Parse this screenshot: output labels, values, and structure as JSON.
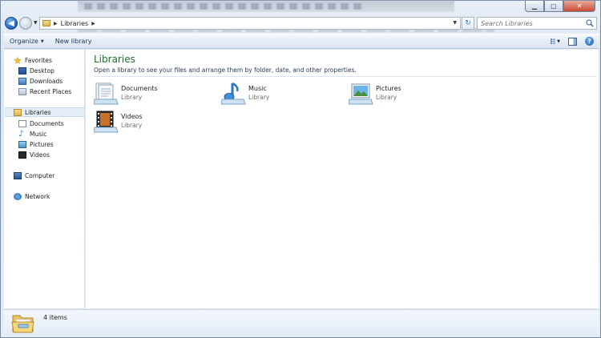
{
  "window": {
    "caption": {
      "minimize": "▁",
      "maximize": "▢",
      "close": "✕"
    }
  },
  "address": {
    "crumb": "Libraries",
    "search_placeholder": "Search Libraries"
  },
  "commandbar": {
    "organize": "Organize",
    "new_library": "New library"
  },
  "navpane": {
    "favorites": {
      "label": "Favorites",
      "items": [
        "Desktop",
        "Downloads",
        "Recent Places"
      ]
    },
    "libraries": {
      "label": "Libraries",
      "items": [
        "Documents",
        "Music",
        "Pictures",
        "Videos"
      ]
    },
    "computer": "Computer",
    "network": "Network"
  },
  "content": {
    "title": "Libraries",
    "subtitle": "Open a library to see your files and arrange them by folder, date, and other properties.",
    "libraries": [
      {
        "name": "Documents",
        "kind": "Library",
        "icon": "documents-library-icon"
      },
      {
        "name": "Music",
        "kind": "Library",
        "icon": "music-library-icon"
      },
      {
        "name": "Pictures",
        "kind": "Library",
        "icon": "pictures-library-icon"
      },
      {
        "name": "Videos",
        "kind": "Library",
        "icon": "videos-library-icon"
      }
    ]
  },
  "details": {
    "count": "4 items"
  },
  "colors": {
    "title_green": "#1e6c2b",
    "selection": "#e5eef8",
    "link_blue": "#1e395b"
  }
}
